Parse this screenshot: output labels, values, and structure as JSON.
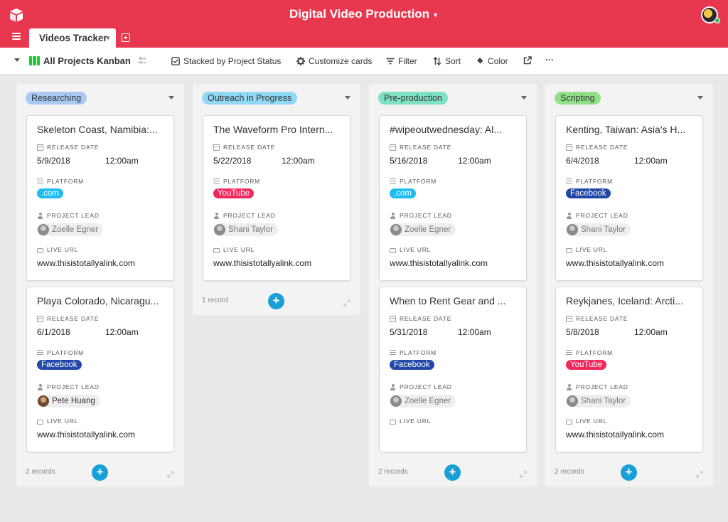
{
  "app": {
    "base_title": "Digital Video Production",
    "table_tab": "Videos Tracker"
  },
  "toolbar": {
    "view_name": "All Projects Kanban",
    "stacked": "Stacked by Project Status",
    "customize": "Customize cards",
    "filter": "Filter",
    "sort": "Sort",
    "color": "Color",
    "more": "···"
  },
  "fields": {
    "release_date": "RELEASE DATE",
    "platform": "PLATFORM",
    "project_lead": "PROJECT LEAD",
    "live_url": "LIVE URL"
  },
  "columns": [
    {
      "name": "Researching",
      "color": "#a9c9f5",
      "footer": "2 records",
      "cards": [
        {
          "title": "Skeleton Coast, Namibia:...",
          "date": "5/9/2018",
          "time": "12:00am",
          "platform": ".com",
          "platform_color": "#1fbcf4",
          "lead": "Zoelle Egner",
          "url": "www.thisistotallyalink.com"
        },
        {
          "title": "Playa Colorado, Nicaragu...",
          "date": "6/1/2018",
          "time": "12:00am",
          "platform": "Facebook",
          "platform_color": "#2247a8",
          "lead": "Pete Huang",
          "url": "www.thisistotallyalink.com"
        }
      ]
    },
    {
      "name": "Outreach in Progress",
      "color": "#8fd9f5",
      "footer": "1 record",
      "cards": [
        {
          "title": "The Waveform Pro Intern...",
          "date": "5/22/2018",
          "time": "12:00am",
          "platform": "YouTube",
          "platform_color": "#f0285c",
          "lead": "Shani Taylor",
          "url": "www.thisistotallyalink.com"
        }
      ]
    },
    {
      "name": "Pre-production",
      "color": "#7fe0c3",
      "footer": "2 records",
      "cards": [
        {
          "title": "#wipeoutwednesday: Al...",
          "date": "5/16/2018",
          "time": "12:00am",
          "platform": ".com",
          "platform_color": "#1fbcf4",
          "lead": "Zoelle Egner",
          "url": "www.thisistotallyalink.com"
        },
        {
          "title": "When to Rent Gear and ...",
          "date": "5/31/2018",
          "time": "12:00am",
          "platform": "Facebook",
          "platform_color": "#2247a8",
          "lead": "Zoelle Egner",
          "url": ""
        }
      ]
    },
    {
      "name": "Scripting",
      "color": "#93e08a",
      "footer": "2 records",
      "cards": [
        {
          "title": "Kenting, Taiwan: Asia's H...",
          "date": "6/4/2018",
          "time": "12:00am",
          "platform": "Facebook",
          "platform_color": "#2247a8",
          "lead": "Shani Taylor",
          "url": "www.thisistotallyalink.com"
        },
        {
          "title": "Reykjanes, Iceland: Arcti...",
          "date": "5/8/2018",
          "time": "12:00am",
          "platform": "YouTube",
          "platform_color": "#f0285c",
          "lead": "Shani Taylor",
          "url": "www.thisistotallyalink.com"
        }
      ]
    }
  ]
}
